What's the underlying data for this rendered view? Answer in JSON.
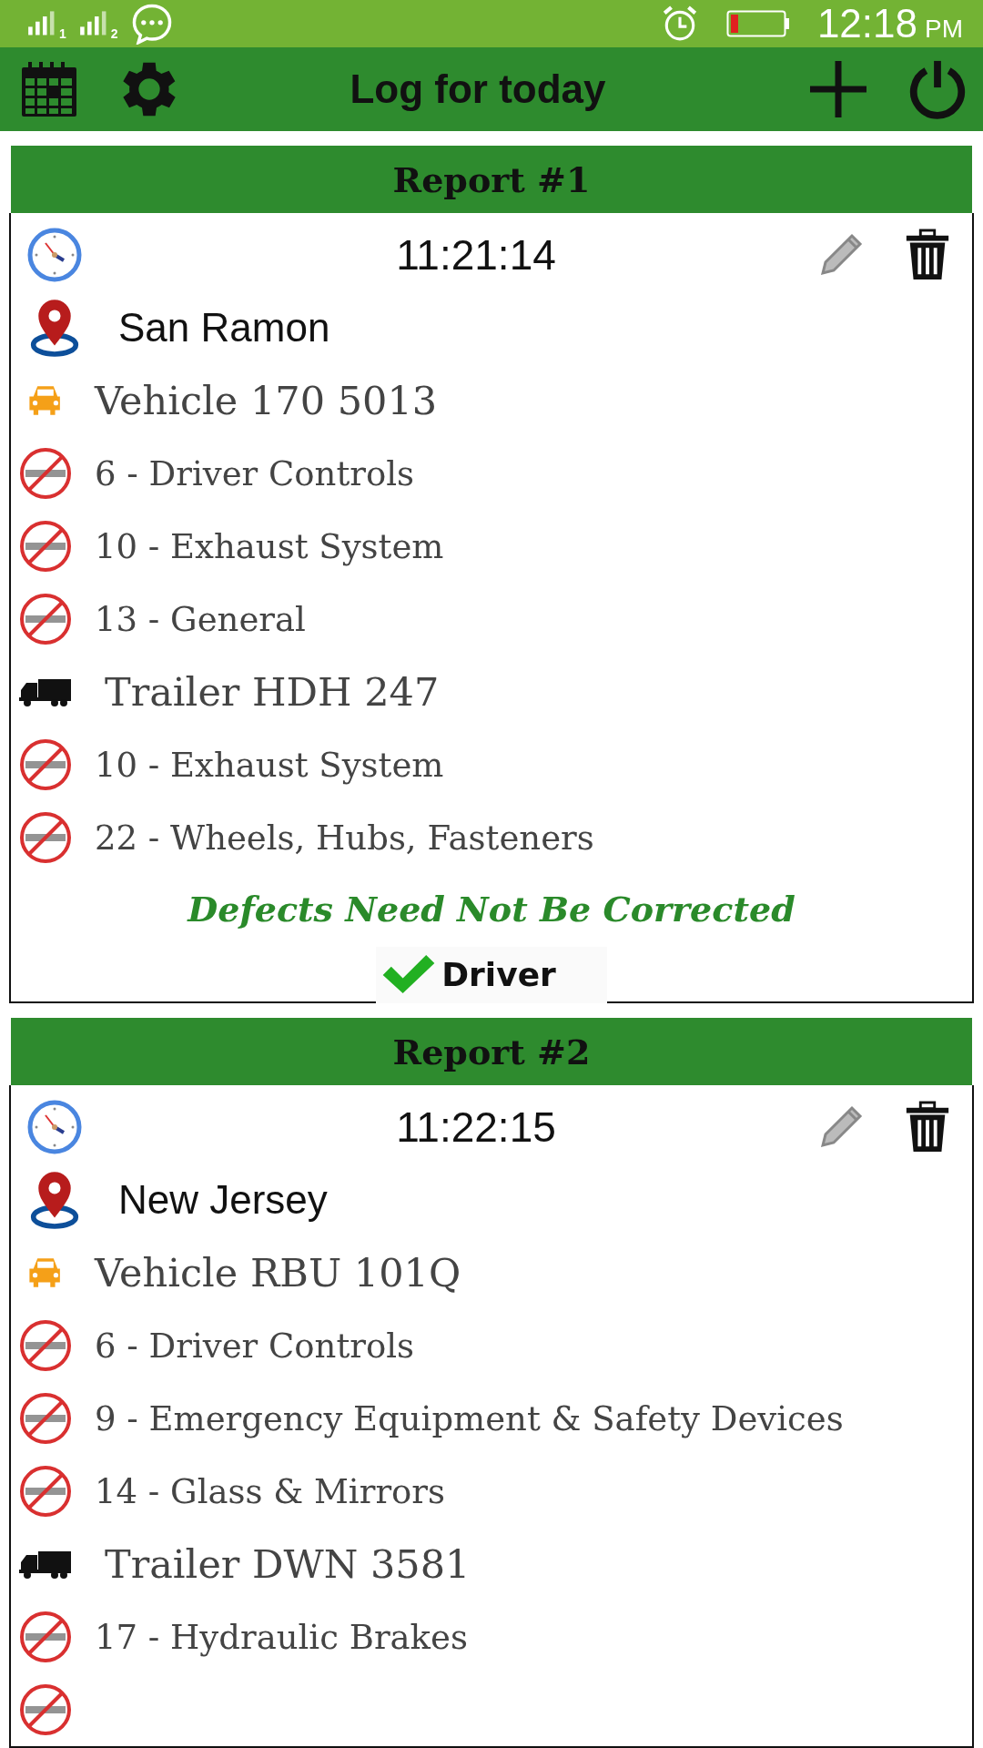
{
  "status_bar": {
    "sims": [
      {
        "label": "1"
      },
      {
        "label": "2"
      }
    ],
    "time": "12:18",
    "period": "PM"
  },
  "toolbar": {
    "title": "Log for today"
  },
  "reports": [
    {
      "title": "Report #1",
      "time": "11:21:14",
      "location": "San Ramon",
      "items": [
        {
          "kind": "vehicle",
          "text": "Vehicle 170 5013"
        },
        {
          "kind": "defect",
          "text": "6 - Driver Controls"
        },
        {
          "kind": "defect",
          "text": "10 - Exhaust System"
        },
        {
          "kind": "defect",
          "text": "13 - General"
        },
        {
          "kind": "trailer",
          "text": "Trailer HDH 247"
        },
        {
          "kind": "defect",
          "text": "10 - Exhaust System"
        },
        {
          "kind": "defect",
          "text": "22 - Wheels, Hubs, Fasteners"
        }
      ],
      "note": "Defects Need Not Be Corrected",
      "signature": {
        "label": "Driver",
        "signed": true
      }
    },
    {
      "title": "Report #2",
      "time": "11:22:15",
      "location": "New Jersey",
      "items": [
        {
          "kind": "vehicle",
          "text": "Vehicle RBU 101Q"
        },
        {
          "kind": "defect",
          "text": "6 - Driver Controls"
        },
        {
          "kind": "defect",
          "text": "9 - Emergency Equipment & Safety Devices"
        },
        {
          "kind": "defect",
          "text": "14 - Glass & Mirrors"
        },
        {
          "kind": "trailer",
          "text": "Trailer DWN 3581"
        },
        {
          "kind": "defect",
          "text": "17 - Hydraulic Brakes"
        },
        {
          "kind": "defect"
        }
      ]
    }
  ]
}
